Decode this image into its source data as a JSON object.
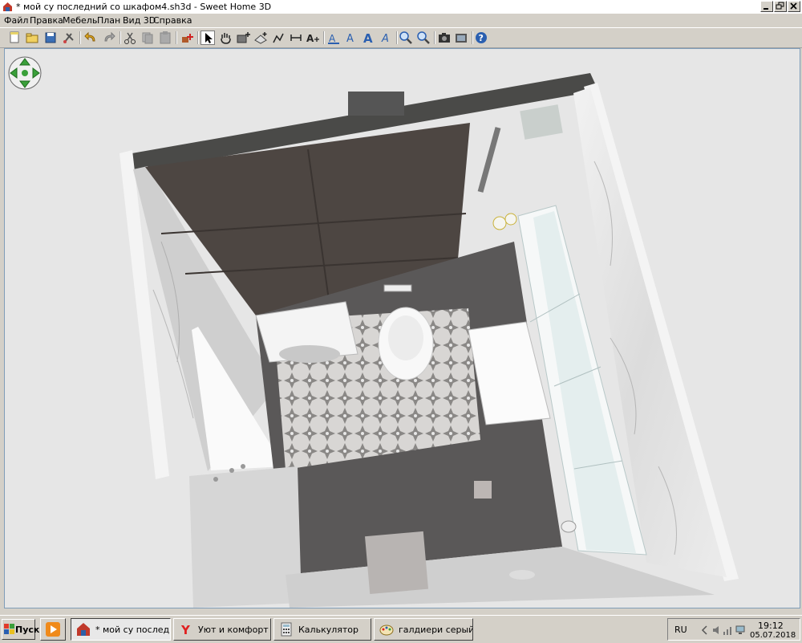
{
  "window": {
    "title": "* мой су последний со шкафом4.sh3d - Sweet Home 3D",
    "minimize_icon": "minimize-icon",
    "maximize_icon": "restore-icon",
    "close_icon": "close-icon"
  },
  "menu": {
    "items": [
      "Файл",
      "Правка",
      "Мебель",
      "План",
      "Вид 3D",
      "Справка"
    ]
  },
  "toolbar": {
    "icons": [
      "new-icon",
      "open-icon",
      "save-icon",
      "preferences-icon",
      "undo-icon",
      "redo-icon",
      "cut-icon",
      "copy-icon",
      "paste-icon",
      "add-furniture-icon",
      "select-icon",
      "pan-icon",
      "create-walls-icon",
      "create-rooms-icon",
      "create-polylines-icon",
      "create-dimensions-icon",
      "add-text-icon",
      "text-style-icon",
      "increase-text-icon",
      "decrease-text-icon",
      "italic-text-icon",
      "zoom-in-icon",
      "zoom-out-icon",
      "photo-icon",
      "video-icon",
      "help-icon"
    ]
  },
  "view3d": {
    "navigation_icon": "navigation-arrows-icon"
  },
  "taskbar": {
    "start_label": "Пуск",
    "tasks": [
      {
        "label": "* мой су последни...",
        "icon": "sweet-home-3d-icon"
      },
      {
        "label": "Уют и комфорт в с...",
        "icon": "yandex-browser-icon"
      },
      {
        "label": "Калькулятор",
        "icon": "calculator-icon"
      },
      {
        "label": "галдиери серый те...",
        "icon": "paint-icon"
      }
    ],
    "quicklaunch_icon": "media-player-icon",
    "language": "RU",
    "time": "19:12",
    "date": "05.07.2018"
  },
  "colors": {
    "accent": "#0a246a",
    "wall_dark": "#4a4340",
    "floor_dark": "#5a5858"
  }
}
